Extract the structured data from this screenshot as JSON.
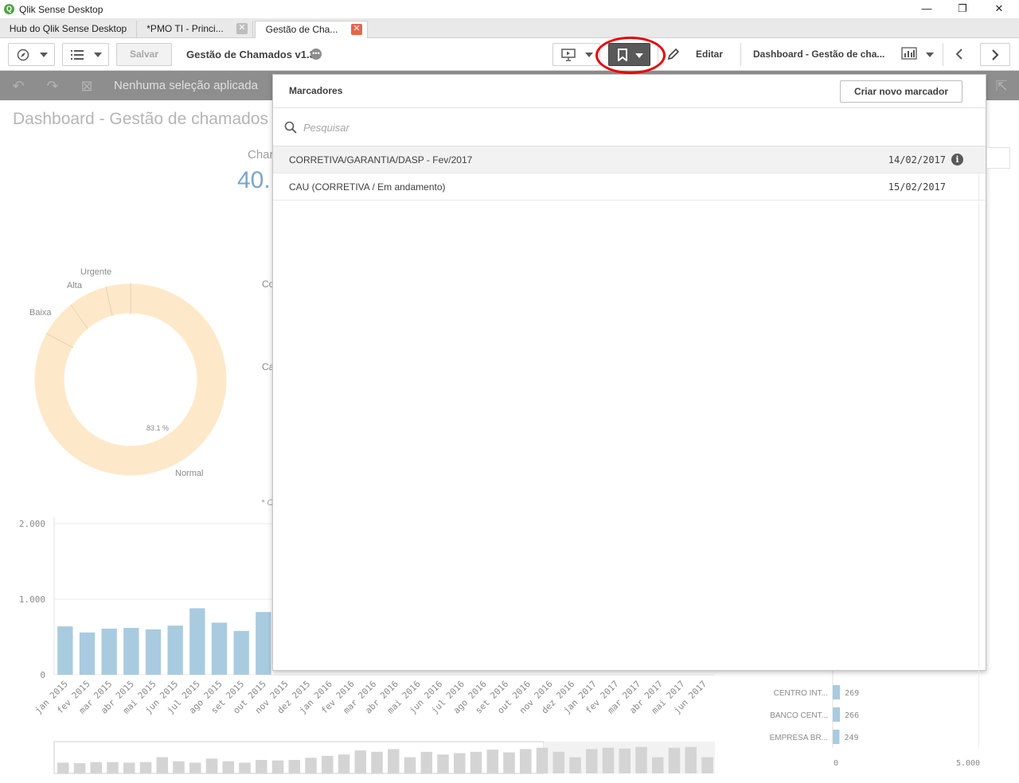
{
  "window": {
    "title": "Qlik Sense Desktop",
    "logo_letter": "Q",
    "minimize": "—",
    "restore": "❐",
    "close": "✕"
  },
  "tabs": [
    {
      "label": "Hub do Qlik Sense Desktop"
    },
    {
      "label": "*PMO TI - Princi..."
    },
    {
      "label": "Gestão de Cha..."
    }
  ],
  "toolbar": {
    "save_label": "Salvar",
    "app_title": "Gestão de Chamados v1.3",
    "edit_label": "Editar",
    "sheet_selector": "Dashboard - Gestão de cha..."
  },
  "selections": {
    "text": "Nenhuma seleção aplicada"
  },
  "sheet": {
    "title": "Dashboard - Gestão de chamados",
    "kpi_label": "Char",
    "kpi_value": "40.",
    "side_label_1": "Co",
    "side_label_2": "Ca",
    "footnote": "* C"
  },
  "donut": {
    "labels": [
      "Urgente",
      "Alta",
      "Baixa",
      "Normal"
    ],
    "center_pct": "83.1 %",
    "color": "#fde9c9"
  },
  "chart_data": [
    {
      "type": "bar",
      "categories": [
        "jan 2015",
        "fev 2015",
        "mar 2015",
        "abr 2015",
        "mai 2015",
        "jun 2015",
        "jul 2015",
        "ago 2015",
        "set 2015",
        "out 2015",
        "nov 2015",
        "dez 2015",
        "jan 2016",
        "fev 2016",
        "mar 2016",
        "abr 2016",
        "mai 2016",
        "jun 2016",
        "jul 2016",
        "ago 2016",
        "set 2016",
        "out 2016",
        "nov 2016",
        "dez 2016",
        "jan 2017",
        "fev 2017",
        "mar 2017",
        "abr 2017",
        "mai 2017",
        "jun 2017"
      ],
      "values": [
        640,
        560,
        610,
        620,
        600,
        650,
        880,
        690,
        580,
        830
      ],
      "yticks": [
        "2.000",
        "1.000",
        "0"
      ],
      "ylim": [
        0,
        2000
      ],
      "color": "#a9cbe0"
    },
    {
      "type": "bar",
      "orientation": "horizontal",
      "categories": [
        "CENTRO INT...",
        "BANCO CENT...",
        "EMPRESA BR..."
      ],
      "values": [
        269,
        266,
        249
      ],
      "value_labels": [
        "269",
        "266",
        "249"
      ],
      "xticks": [
        "0",
        "5.000"
      ],
      "xlim": [
        0,
        5000
      ],
      "color": "#a9cbe0"
    }
  ],
  "bookmarks": {
    "header": "Marcadores",
    "create_label": "Criar novo marcador",
    "search_placeholder": "Pesquisar",
    "items": [
      {
        "name": "CORRETIVA/GARANTIA/DASP - Fev/2017",
        "date": "14/02/2017",
        "info": "i"
      },
      {
        "name": "CAU (CORRETIVA / Em andamento)",
        "date": "15/02/2017"
      }
    ]
  },
  "colors": {
    "accent_red": "#e60000",
    "selection_bar": "#8e8e8e",
    "bar_blue": "#a9cbe0",
    "scroll_grey": "#d4d4d4"
  }
}
